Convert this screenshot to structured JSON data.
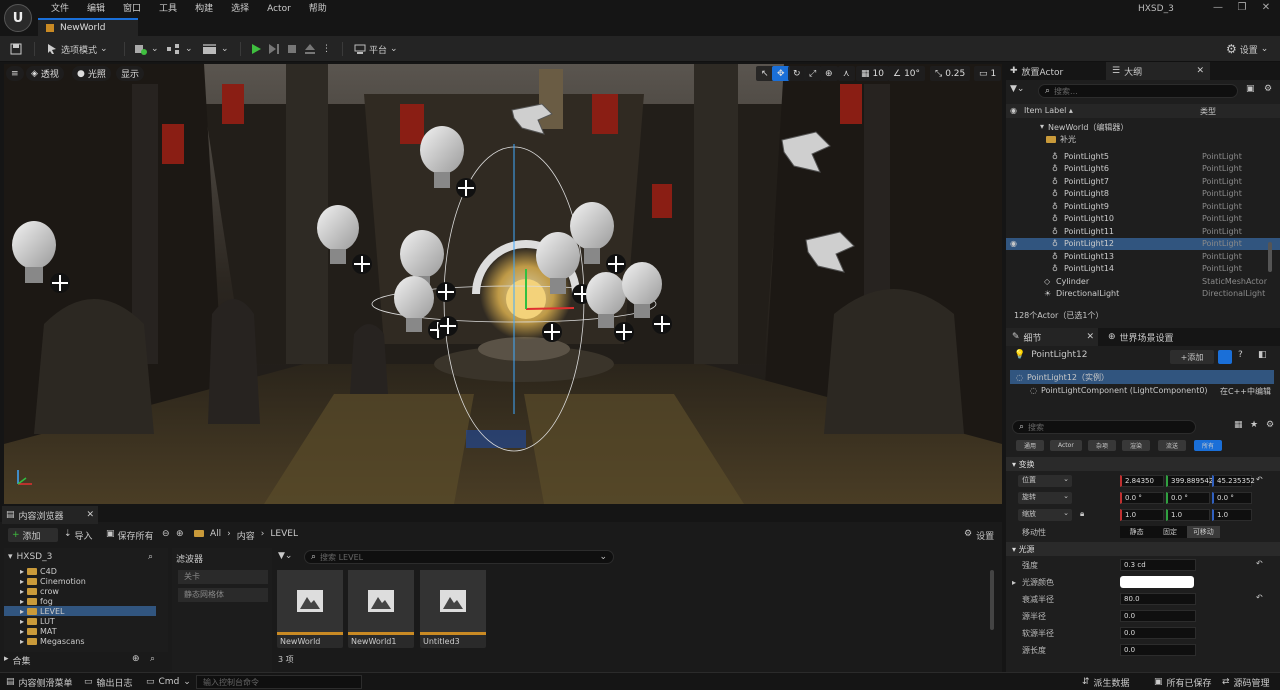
{
  "menu": [
    "文件",
    "编辑",
    "窗口",
    "工具",
    "构建",
    "选择",
    "Actor",
    "帮助"
  ],
  "document_tab": "NewWorld",
  "project_name": "HXSD_3",
  "toolbar": {
    "mode_label": "选项模式",
    "platform_label": "平台",
    "settings_label": "设置"
  },
  "viewport": {
    "perspective_label": "透视",
    "lighting_label": "光照",
    "show_label": "显示",
    "grid_snap": "10",
    "rot_snap": "10°",
    "scale_snap": "0.25",
    "camera_speed": "1"
  },
  "outliner": {
    "place_actor_tab": "放置Actor",
    "outliner_tab": "大纲",
    "search_placeholder": "搜索...",
    "col_label": "Item Label ▴",
    "col_type": "类型",
    "world_row": "NewWorld（编辑器）",
    "folder_row": "补光",
    "rows": [
      {
        "name": "PointLight5",
        "type": "PointLight"
      },
      {
        "name": "PointLight6",
        "type": "PointLight"
      },
      {
        "name": "PointLight7",
        "type": "PointLight"
      },
      {
        "name": "PointLight8",
        "type": "PointLight"
      },
      {
        "name": "PointLight9",
        "type": "PointLight"
      },
      {
        "name": "PointLight10",
        "type": "PointLight"
      },
      {
        "name": "PointLight11",
        "type": "PointLight"
      },
      {
        "name": "PointLight12",
        "type": "PointLight"
      },
      {
        "name": "PointLight13",
        "type": "PointLight"
      },
      {
        "name": "PointLight14",
        "type": "PointLight"
      },
      {
        "name": "Cylinder",
        "type": "StaticMeshActor"
      },
      {
        "name": "DirectionalLight",
        "type": "DirectionalLight"
      }
    ],
    "selected_index": 7,
    "count_text": "128个Actor（已选1个）"
  },
  "details": {
    "details_tab": "细节",
    "world_settings_tab": "世界场景设置",
    "actor_name": "PointLight12",
    "add_label": "+添加",
    "instance_label": "PointLight12（实例）",
    "component_label": "PointLightComponent (LightComponent0)",
    "edit_cpp_label": "在C++中编辑",
    "search_placeholder": "搜索",
    "filters": [
      "通用",
      "Actor",
      "杂项",
      "渲染",
      "流送",
      "所有"
    ],
    "transform_section": "变换",
    "location_label": "位置",
    "rotation_label": "旋转",
    "scale_label": "缩放",
    "location": [
      "2.84350",
      "399.889542",
      "45.235352"
    ],
    "rotation": [
      "0.0 °",
      "0.0 °",
      "0.0 °"
    ],
    "scale": [
      "1.0",
      "1.0",
      "1.0"
    ],
    "mobility_label": "移动性",
    "mobility": [
      "静态",
      "固定",
      "可移动"
    ],
    "light_section": "光源",
    "intensity_label": "强度",
    "intensity": "0.3 cd",
    "color_label": "光源颜色",
    "atten_label": "衰减半径",
    "atten": "80.0",
    "source_radius_label": "源半径",
    "source_radius": "0.0",
    "soft_radius_label": "软源半径",
    "soft_radius": "0.0",
    "source_length_label": "源长度",
    "source_length": "0.0"
  },
  "content_browser": {
    "tab_label": "内容浏览器",
    "add_label": "添加",
    "import_label": "导入",
    "save_all_label": "保存所有",
    "breadcrumb": [
      "All",
      "内容",
      "LEVEL"
    ],
    "settings_label": "设置",
    "root_label": "HXSD_3",
    "folders": [
      "C4D",
      "Cinemotion",
      "crow",
      "fog",
      "LEVEL",
      "LUT",
      "MAT",
      "Megascans"
    ],
    "selected_folder": 4,
    "collections_label": "合集",
    "filters_label": "滤波器",
    "filter_items": [
      "关卡",
      "静态网格体"
    ],
    "search_placeholder": "搜索 LEVEL",
    "assets": [
      "NewWorld",
      "NewWorld1",
      "Untitled3"
    ],
    "item_count": "3 项"
  },
  "statusbar": {
    "drawer_label": "内容侧滑菜单",
    "log_label": "输出日志",
    "cmd_label": "Cmd",
    "console_placeholder": "输入控制台命令",
    "derived_label": "派生数据",
    "saved_label": "所有已保存",
    "source_label": "源码管理"
  },
  "colors": {
    "accent": "#1a6fd8",
    "selected_row": "#31557f",
    "asset_bar": "#c98a24",
    "play_green": "#3fbf3f"
  }
}
